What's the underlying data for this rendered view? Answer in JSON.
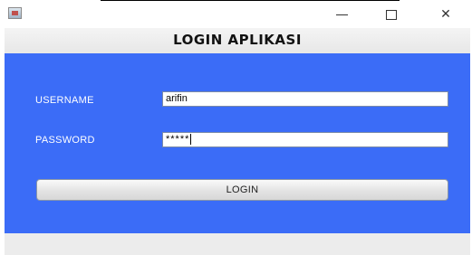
{
  "window": {
    "icon": "java-app-icon",
    "controls": {
      "minimize": "minimize-icon",
      "maximize": "maximize-icon",
      "close_glyph": "✕"
    }
  },
  "header": {
    "title": "LOGIN APLIKASI"
  },
  "form": {
    "username_label": "USERNAME",
    "username_value": "arifin",
    "password_label": "PASSWORD",
    "password_value": "*****",
    "login_label": "LOGIN"
  },
  "colors": {
    "panel_background": "#3b6cf7",
    "label_text": "#ffffff"
  }
}
